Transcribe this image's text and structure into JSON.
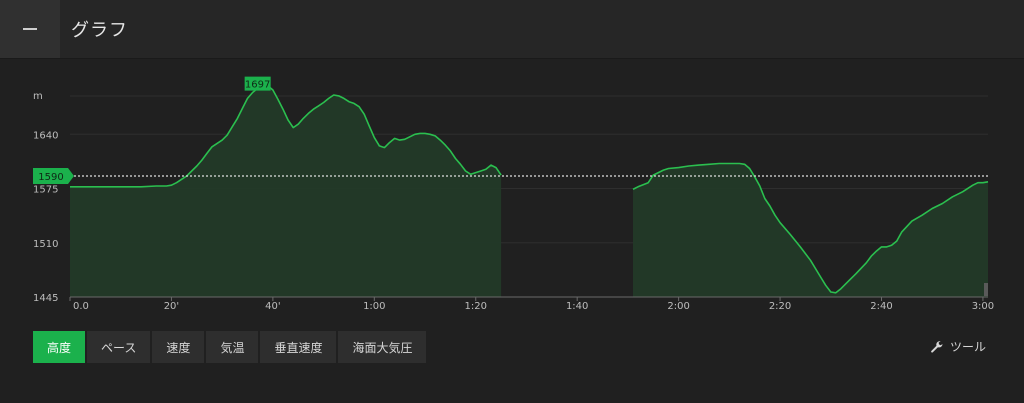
{
  "header": {
    "menu_icon": "minus-icon",
    "title": "グラフ"
  },
  "chart_data": {
    "type": "area",
    "ylabel": "m",
    "y_ticks": [
      "1640",
      "1575",
      "1510",
      "1445"
    ],
    "x_ticks": [
      "0.0",
      "20'",
      "40'",
      "1:00",
      "1:20",
      "1:40",
      "2:00",
      "2:20",
      "2:40",
      "3:00"
    ],
    "xlim_minutes": [
      0,
      181
    ],
    "ylim": [
      1445,
      1705
    ],
    "reference_value": "1590",
    "max_marker": {
      "label": "1697",
      "x": 37,
      "y": 1697
    },
    "colors": {
      "line": "#2bbf4f",
      "fill": "#223b28",
      "marker": "#1bb14c"
    },
    "series": [
      {
        "values": [
          [
            0,
            1577
          ],
          [
            10,
            1577
          ],
          [
            14,
            1577
          ],
          [
            17,
            1578
          ],
          [
            19,
            1578
          ],
          [
            20,
            1579
          ],
          [
            21,
            1582
          ],
          [
            22,
            1586
          ],
          [
            23,
            1590
          ],
          [
            24,
            1596
          ],
          [
            25,
            1602
          ],
          [
            26,
            1609
          ],
          [
            27,
            1617
          ],
          [
            28,
            1625
          ],
          [
            29,
            1629
          ],
          [
            30,
            1633
          ],
          [
            31,
            1639
          ],
          [
            32,
            1649
          ],
          [
            33,
            1659
          ],
          [
            34,
            1671
          ],
          [
            35,
            1683
          ],
          [
            36,
            1690
          ],
          [
            37,
            1695
          ],
          [
            38,
            1697
          ],
          [
            39,
            1698
          ],
          [
            40,
            1693
          ],
          [
            41,
            1682
          ],
          [
            42,
            1670
          ],
          [
            43,
            1657
          ],
          [
            44,
            1648
          ],
          [
            45,
            1652
          ],
          [
            46,
            1659
          ],
          [
            47,
            1665
          ],
          [
            48,
            1670
          ],
          [
            49,
            1674
          ],
          [
            50,
            1678
          ],
          [
            51,
            1683
          ],
          [
            52,
            1687
          ],
          [
            53,
            1686
          ],
          [
            54,
            1683
          ],
          [
            55,
            1679
          ],
          [
            56,
            1677
          ],
          [
            57,
            1673
          ],
          [
            58,
            1664
          ],
          [
            59,
            1650
          ],
          [
            60,
            1636
          ],
          [
            61,
            1626
          ],
          [
            62,
            1624
          ],
          [
            63,
            1630
          ],
          [
            64,
            1635
          ],
          [
            65,
            1633
          ],
          [
            66,
            1634
          ],
          [
            67,
            1637
          ],
          [
            68,
            1640
          ],
          [
            69,
            1641
          ],
          [
            70,
            1641
          ],
          [
            71,
            1640
          ],
          [
            72,
            1638
          ],
          [
            73,
            1633
          ],
          [
            74,
            1627
          ],
          [
            75,
            1620
          ],
          [
            76,
            1611
          ],
          [
            77,
            1604
          ],
          [
            78,
            1596
          ],
          [
            79,
            1592
          ],
          [
            80,
            1594
          ],
          [
            81,
            1596
          ],
          [
            82,
            1598
          ],
          [
            83,
            1603
          ],
          [
            84,
            1600
          ],
          [
            85,
            1591
          ]
        ]
      },
      {
        "values": [
          [
            111,
            1574
          ],
          [
            112,
            1577
          ],
          [
            114,
            1582
          ],
          [
            115,
            1591
          ],
          [
            117,
            1597
          ],
          [
            118,
            1599
          ],
          [
            120,
            1600
          ],
          [
            122,
            1602
          ],
          [
            124,
            1603
          ],
          [
            126,
            1604
          ],
          [
            128,
            1605
          ],
          [
            130,
            1605
          ],
          [
            132,
            1605
          ],
          [
            133,
            1604
          ],
          [
            134,
            1599
          ],
          [
            135,
            1589
          ],
          [
            136,
            1578
          ],
          [
            137,
            1563
          ],
          [
            138,
            1554
          ],
          [
            139,
            1543
          ],
          [
            140,
            1534
          ],
          [
            142,
            1520
          ],
          [
            144,
            1505
          ],
          [
            146,
            1489
          ],
          [
            148,
            1469
          ],
          [
            149,
            1459
          ],
          [
            150,
            1451
          ],
          [
            151,
            1450
          ],
          [
            152,
            1455
          ],
          [
            153,
            1461
          ],
          [
            155,
            1473
          ],
          [
            157,
            1486
          ],
          [
            158,
            1494
          ],
          [
            159,
            1500
          ],
          [
            160,
            1505
          ],
          [
            161,
            1505
          ],
          [
            162,
            1507
          ],
          [
            163,
            1512
          ],
          [
            164,
            1523
          ],
          [
            166,
            1536
          ],
          [
            168,
            1543
          ],
          [
            170,
            1551
          ],
          [
            172,
            1557
          ],
          [
            174,
            1565
          ],
          [
            176,
            1571
          ],
          [
            178,
            1579
          ],
          [
            179,
            1582
          ],
          [
            180,
            1582
          ],
          [
            181,
            1583
          ]
        ]
      }
    ]
  },
  "tabs": [
    {
      "label": "高度",
      "active": true
    },
    {
      "label": "ペース",
      "active": false
    },
    {
      "label": "速度",
      "active": false
    },
    {
      "label": "気温",
      "active": false
    },
    {
      "label": "垂直速度",
      "active": false
    },
    {
      "label": "海面大気圧",
      "active": false
    }
  ],
  "tools": {
    "icon": "wrench-icon",
    "label": "ツール"
  }
}
